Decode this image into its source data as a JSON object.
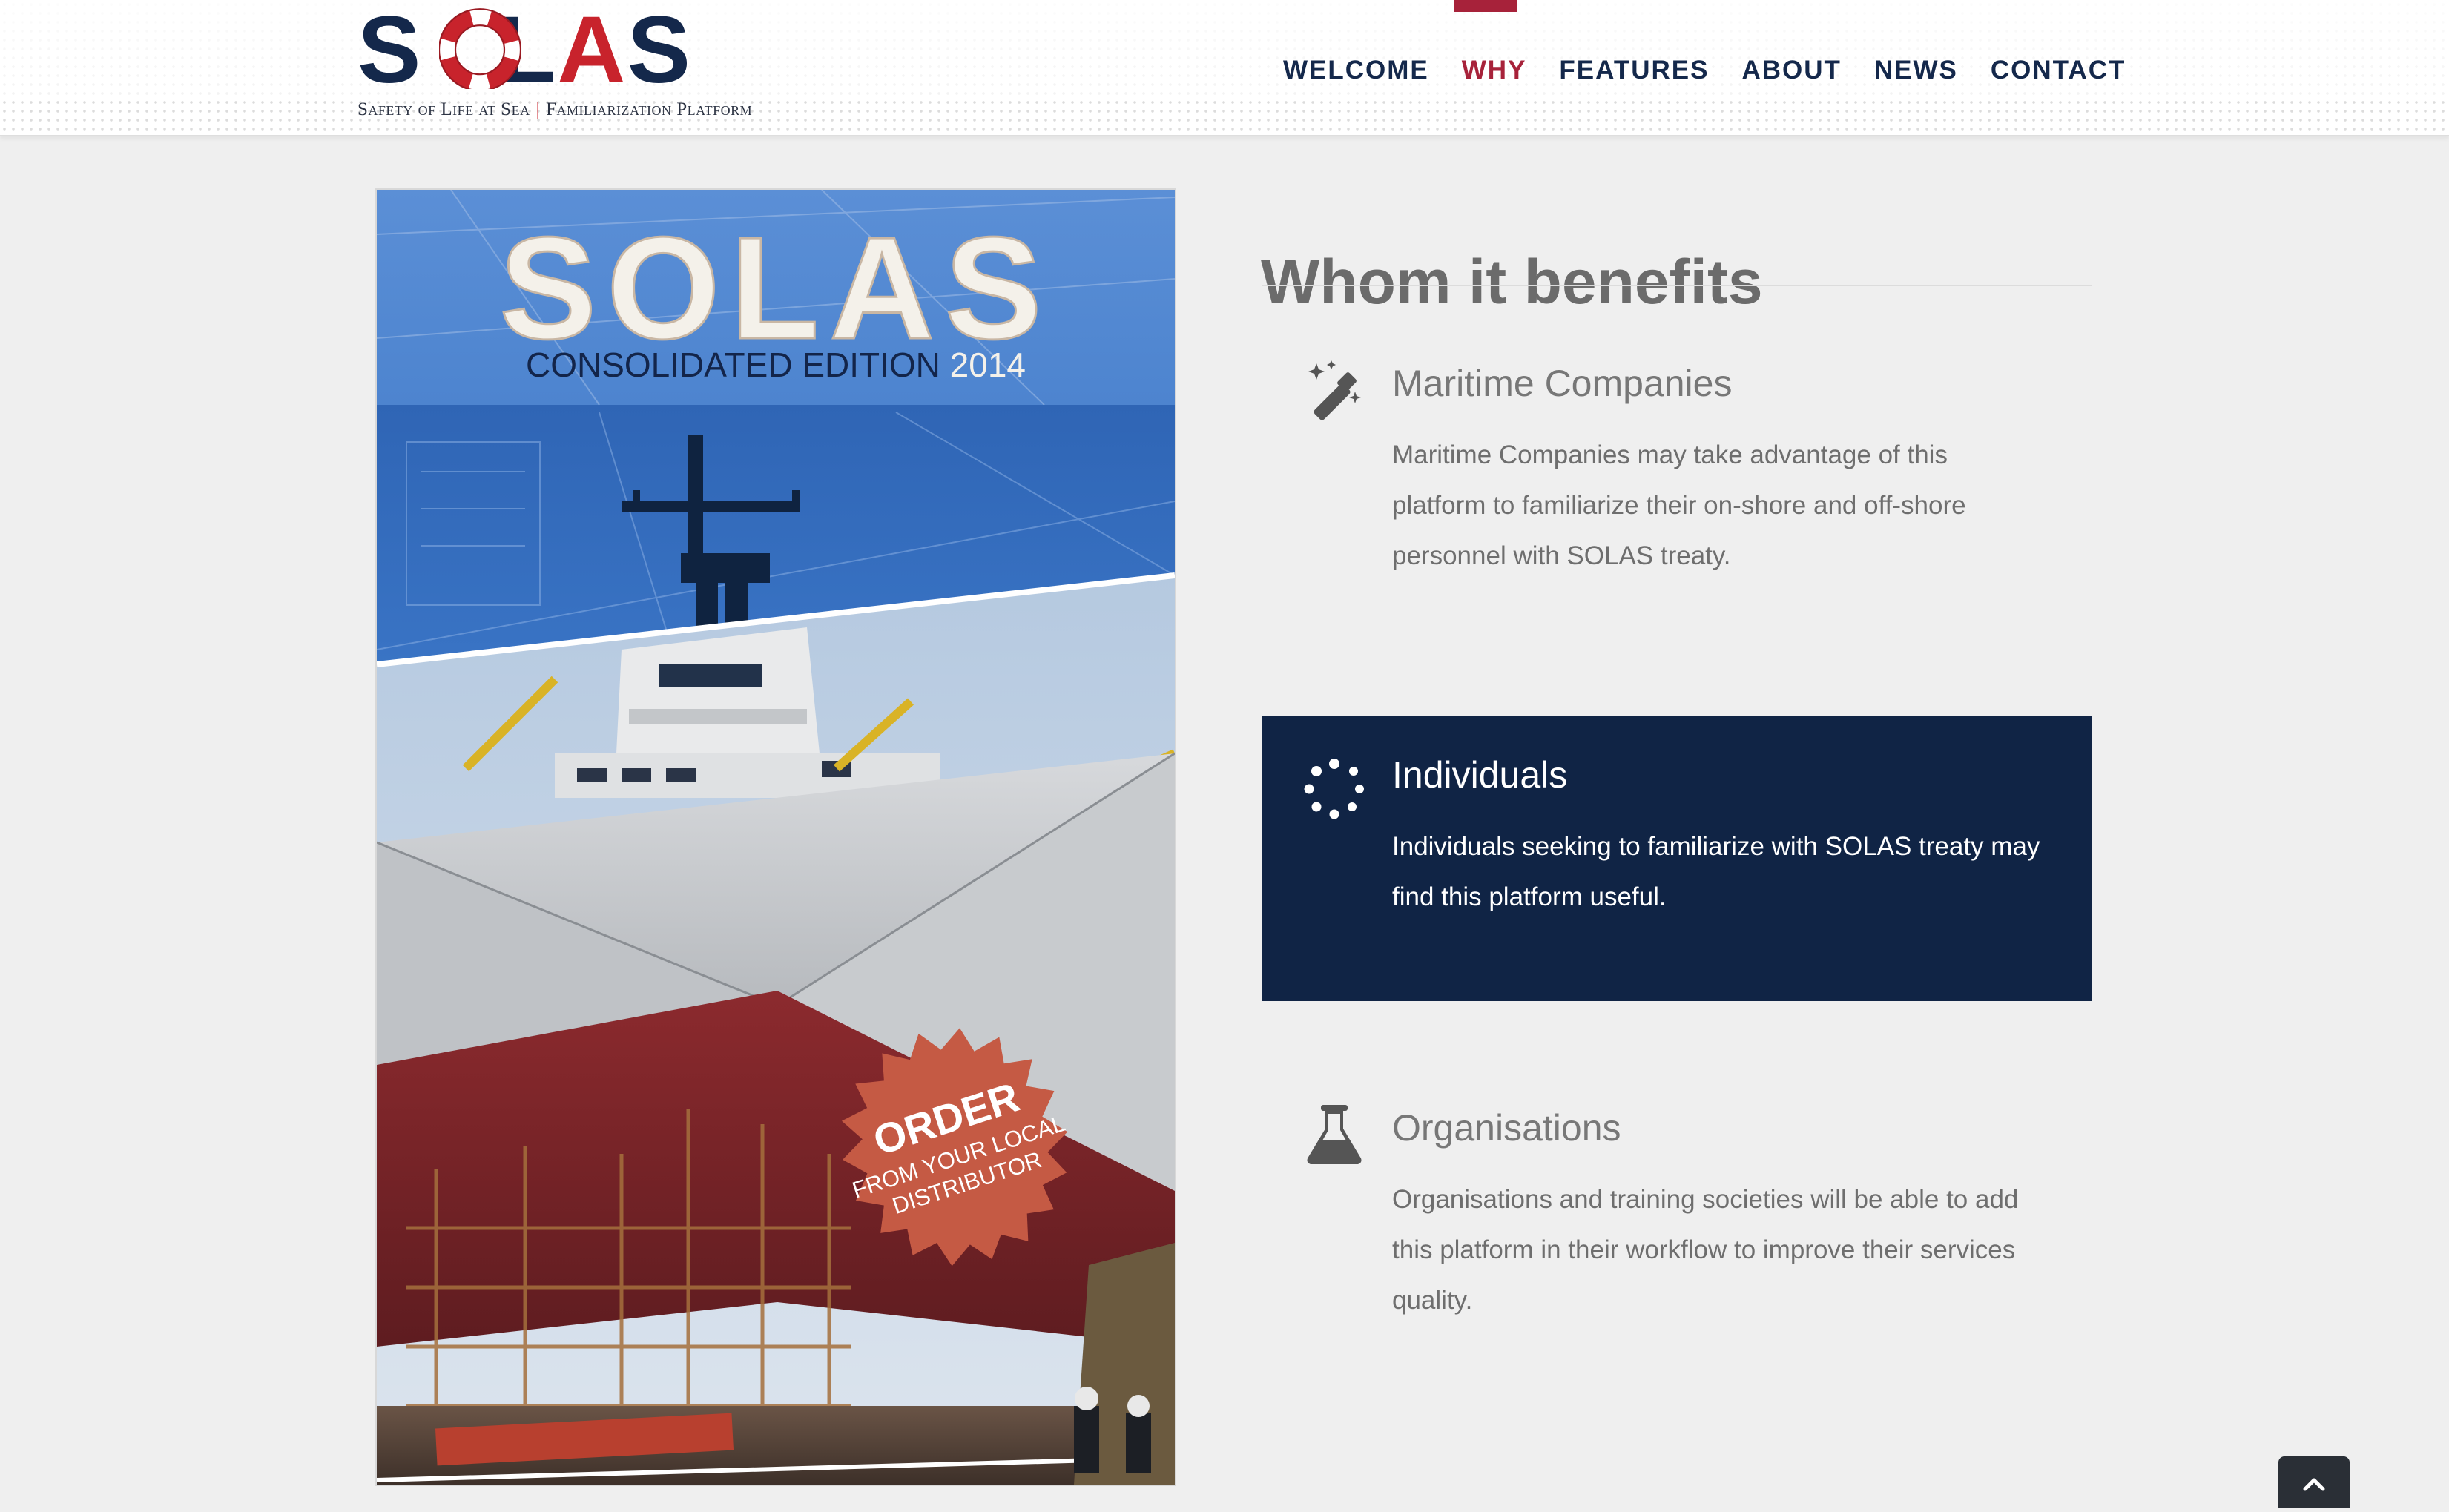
{
  "header": {
    "logo": {
      "word": "SOLAS",
      "tagline_left": "Safety of Life at Sea",
      "tagline_separator": "|",
      "tagline_right": "Familiarization Platform"
    },
    "nav": [
      {
        "label": "WELCOME",
        "active": false
      },
      {
        "label": "WHY",
        "active": true
      },
      {
        "label": "FEATURES",
        "active": false
      },
      {
        "label": "ABOUT",
        "active": false
      },
      {
        "label": "NEWS",
        "active": false
      },
      {
        "label": "CONTACT",
        "active": false
      }
    ]
  },
  "book_cover": {
    "title": "SOLAS",
    "subtitle": "CONSOLIDATED EDITION",
    "year": "2014",
    "badge_line1": "ORDER",
    "badge_line2": "FROM YOUR LOCAL",
    "badge_line3": "DISTRIBUTOR"
  },
  "section": {
    "title": "Whom it benefits",
    "benefits": [
      {
        "icon": "magic-wand-icon",
        "title": "Maritime Companies",
        "text": "Maritime Companies may take advantage of this platform to familiarize their on-shore and off-shore personnel with SOLAS treaty."
      },
      {
        "icon": "spinner-icon",
        "title": "Individuals",
        "text": "Individuals seeking to familiarize with SOLAS treaty may find this platform useful.",
        "highlighted": true
      },
      {
        "icon": "flask-icon",
        "title": "Organisations",
        "text": "Organisations and training societies will be able to add this platform in their workflow to improve their services quality."
      }
    ]
  },
  "back_to_top": {
    "icon": "chevron-up-icon"
  },
  "colors": {
    "navy": "#14284b",
    "accent_red": "#a7223a",
    "highlight_bg": "#102445",
    "page_bg": "#efefef"
  }
}
